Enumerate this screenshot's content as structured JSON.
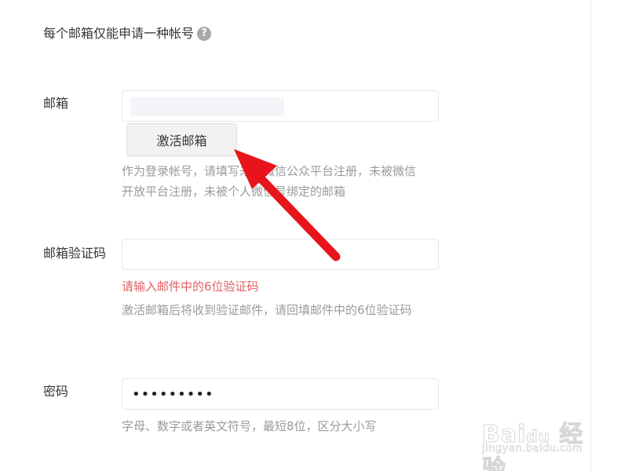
{
  "notice": {
    "text": "每个邮箱仅能申请一种帐号",
    "help_icon": "question-circle-icon",
    "help_glyph": "?"
  },
  "form": {
    "email": {
      "label": "邮箱",
      "value": "",
      "activate_button": "激活邮箱",
      "tip": "作为登录帐号，请填写未被微信公众平台注册，未被微信开放平台注册，未被个人微信号绑定的邮箱"
    },
    "code": {
      "label": "邮箱验证码",
      "value": "",
      "error": "请输入邮件中的6位验证码",
      "tip": "激活邮箱后将收到验证邮件，请回填邮件中的6位验证码"
    },
    "password": {
      "label": "密码",
      "value": "•••••••••",
      "tip": "字母、数字或者英文符号，最短8位，区分大小写"
    }
  },
  "watermark": {
    "main": "Bai 经验",
    "du": "du",
    "sub": "jingyan.baidu.com"
  },
  "colors": {
    "text": "#353535",
    "tip": "#9a9a9a",
    "error": "#e15f63",
    "arrow": "#e8141b",
    "button_bg": "#f2f2f2",
    "border": "#e4e8eb"
  }
}
